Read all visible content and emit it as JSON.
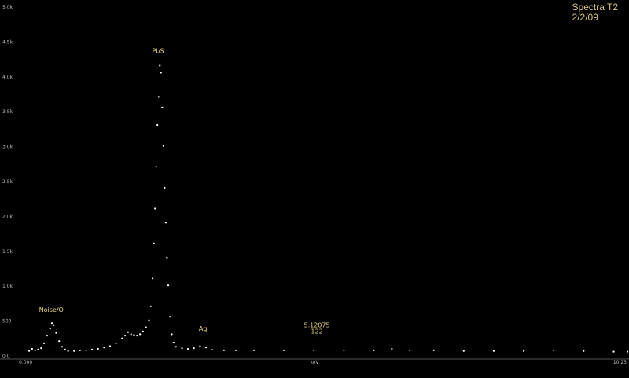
{
  "header": {
    "title": "Spectra T2",
    "date": "2/2/09"
  },
  "colors": {
    "background": "#000000",
    "data_points": "#ffffff",
    "annotation_text": "#e8d878",
    "axis_text": "#bbbbbb",
    "title_text": "#d8c878"
  },
  "chart_data": {
    "type": "scatter",
    "title": "",
    "xlabel": "keV",
    "ylabel": "",
    "xlim": [
      0,
      10.23
    ],
    "ylim": [
      0,
      5.0
    ],
    "grid": false,
    "legend": "none",
    "x_tick_labels": [
      "0.000",
      "keV",
      "10.23"
    ],
    "y_ticks": [
      {
        "value": 0.0,
        "label": "0.0"
      },
      {
        "value": 0.5,
        "label": "500"
      },
      {
        "value": 1.0,
        "label": "1.0k"
      },
      {
        "value": 1.5,
        "label": "1.5k"
      },
      {
        "value": 2.0,
        "label": "2.0k"
      },
      {
        "value": 2.5,
        "label": "2.5k"
      },
      {
        "value": 3.0,
        "label": "3.0k"
      },
      {
        "value": 3.5,
        "label": "3.5k"
      },
      {
        "value": 4.0,
        "label": "4.0k"
      },
      {
        "value": 4.5,
        "label": "4.5k"
      },
      {
        "value": 5.0,
        "label": "5.0k"
      }
    ],
    "annotations": [
      {
        "text": "Noise/O",
        "x": 0.62,
        "y": 0.62
      },
      {
        "text": "PbS",
        "x": 2.4,
        "y": 4.33
      },
      {
        "text": "Ag",
        "x": 3.15,
        "y": 0.35
      },
      {
        "text": "5.12075",
        "x": 5.05,
        "y": 0.4
      },
      {
        "text": "122",
        "x": 5.05,
        "y": 0.31
      }
    ],
    "series": [
      {
        "points": [
          [
            0.25,
            0.06
          ],
          [
            0.3,
            0.09
          ],
          [
            0.35,
            0.07
          ],
          [
            0.4,
            0.08
          ],
          [
            0.45,
            0.1
          ],
          [
            0.5,
            0.17
          ],
          [
            0.55,
            0.28
          ],
          [
            0.6,
            0.38
          ],
          [
            0.63,
            0.46
          ],
          [
            0.66,
            0.43
          ],
          [
            0.7,
            0.32
          ],
          [
            0.75,
            0.2
          ],
          [
            0.8,
            0.12
          ],
          [
            0.85,
            0.08
          ],
          [
            0.9,
            0.06
          ],
          [
            1.0,
            0.06
          ],
          [
            1.1,
            0.07
          ],
          [
            1.2,
            0.07
          ],
          [
            1.3,
            0.08
          ],
          [
            1.4,
            0.09
          ],
          [
            1.5,
            0.11
          ],
          [
            1.6,
            0.13
          ],
          [
            1.7,
            0.17
          ],
          [
            1.8,
            0.24
          ],
          [
            1.85,
            0.28
          ],
          [
            1.9,
            0.33
          ],
          [
            1.95,
            0.3
          ],
          [
            2.0,
            0.29
          ],
          [
            2.05,
            0.28
          ],
          [
            2.1,
            0.3
          ],
          [
            2.15,
            0.34
          ],
          [
            2.2,
            0.4
          ],
          [
            2.25,
            0.5
          ],
          [
            2.28,
            0.7
          ],
          [
            2.31,
            1.1
          ],
          [
            2.33,
            1.6
          ],
          [
            2.35,
            2.1
          ],
          [
            2.37,
            2.7
          ],
          [
            2.39,
            3.3
          ],
          [
            2.41,
            3.7
          ],
          [
            2.43,
            4.15
          ],
          [
            2.45,
            4.05
          ],
          [
            2.47,
            3.55
          ],
          [
            2.49,
            3.0
          ],
          [
            2.51,
            2.4
          ],
          [
            2.53,
            1.9
          ],
          [
            2.55,
            1.4
          ],
          [
            2.57,
            1.0
          ],
          [
            2.6,
            0.55
          ],
          [
            2.63,
            0.3
          ],
          [
            2.66,
            0.18
          ],
          [
            2.7,
            0.12
          ],
          [
            2.8,
            0.1
          ],
          [
            2.9,
            0.09
          ],
          [
            3.0,
            0.1
          ],
          [
            3.1,
            0.13
          ],
          [
            3.2,
            0.11
          ],
          [
            3.3,
            0.08
          ],
          [
            3.5,
            0.07
          ],
          [
            3.7,
            0.07
          ],
          [
            4.0,
            0.07
          ],
          [
            4.5,
            0.07
          ],
          [
            5.0,
            0.07
          ],
          [
            5.5,
            0.07
          ],
          [
            6.0,
            0.07
          ],
          [
            6.3,
            0.09
          ],
          [
            6.6,
            0.07
          ],
          [
            7.0,
            0.07
          ],
          [
            7.5,
            0.06
          ],
          [
            8.0,
            0.06
          ],
          [
            8.5,
            0.06
          ],
          [
            9.0,
            0.07
          ],
          [
            9.5,
            0.06
          ],
          [
            10.0,
            0.05
          ],
          [
            10.23,
            0.05
          ]
        ]
      }
    ]
  }
}
